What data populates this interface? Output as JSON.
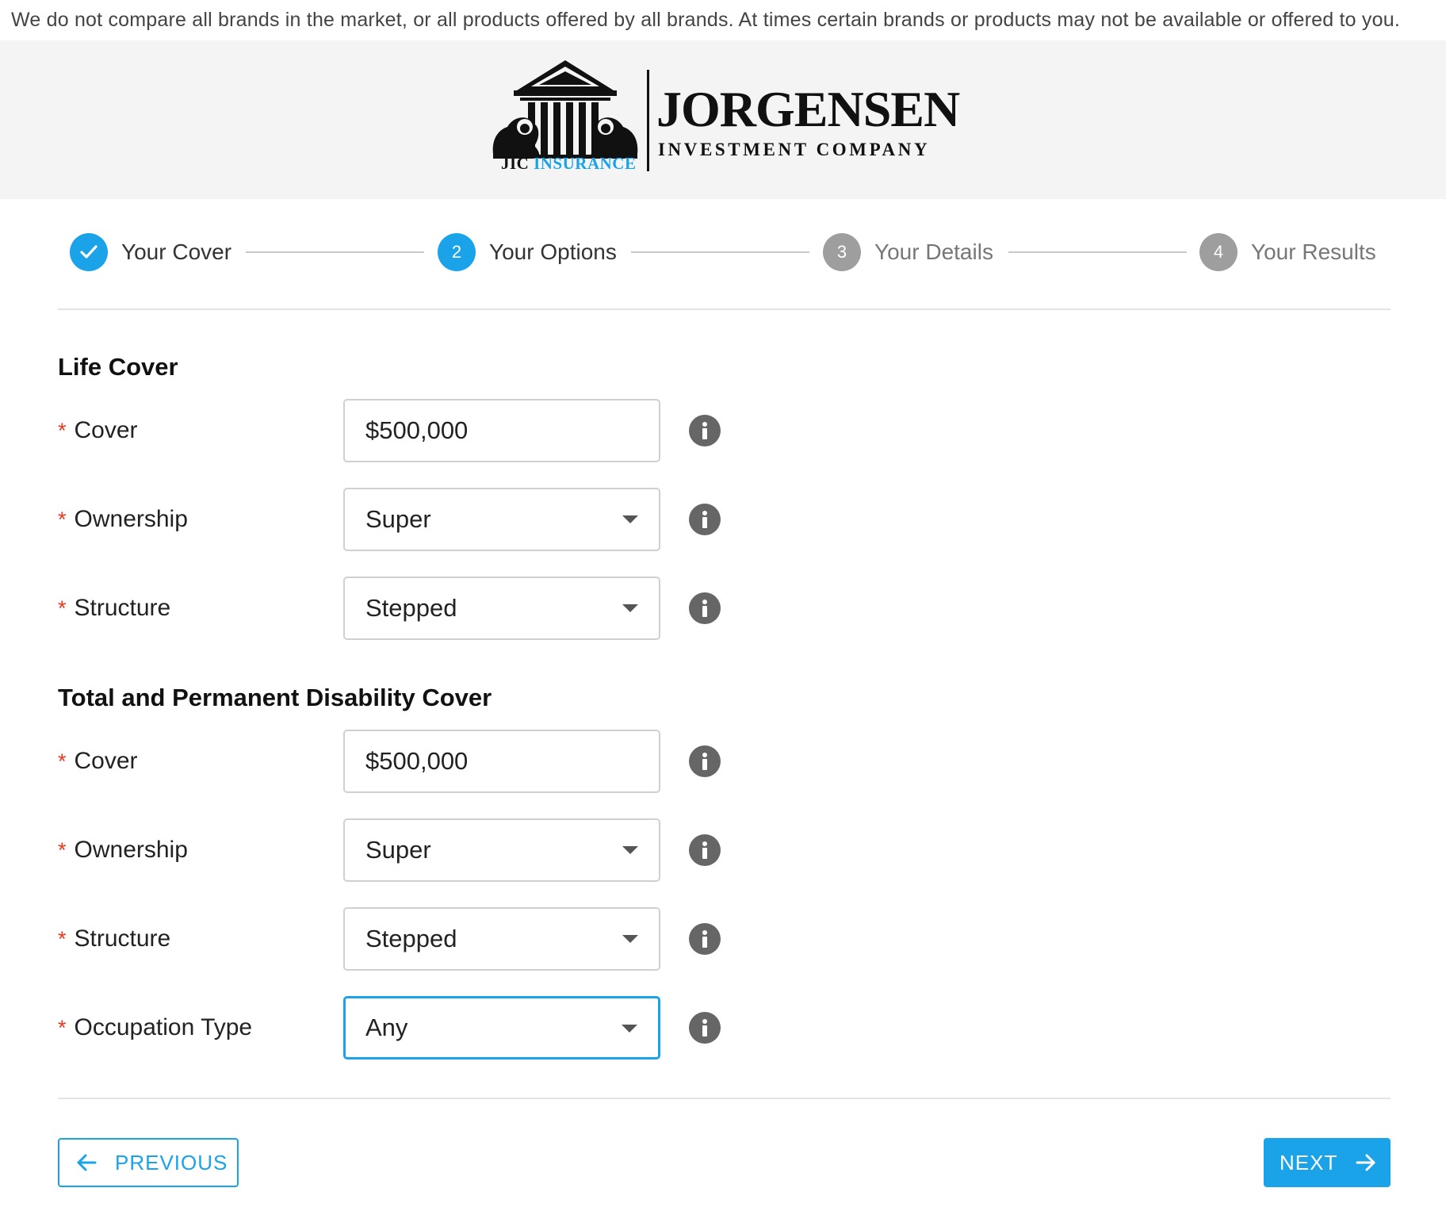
{
  "disclaimer": "We do not compare all brands in the market, or all products offered by all brands. At times certain brands or products may not be available or offered to you.",
  "logo": {
    "name": "JORGENSEN",
    "subtitle": "INVESTMENT COMPANY",
    "tag_prefix": "JIC",
    "tag_suffix": "INSURANCE"
  },
  "stepper": {
    "steps": [
      {
        "number": "",
        "label": "Your Cover",
        "state": "done"
      },
      {
        "number": "2",
        "label": "Your Options",
        "state": "active"
      },
      {
        "number": "3",
        "label": "Your Details",
        "state": "pending"
      },
      {
        "number": "4",
        "label": "Your Results",
        "state": "pending"
      }
    ]
  },
  "life_cover": {
    "title": "Life Cover",
    "cover_label": "Cover",
    "cover_value": "$500,000",
    "ownership_label": "Ownership",
    "ownership_value": "Super",
    "structure_label": "Structure",
    "structure_value": "Stepped"
  },
  "tpd_cover": {
    "title": "Total and Permanent Disability Cover",
    "cover_label": "Cover",
    "cover_value": "$500,000",
    "ownership_label": "Ownership",
    "ownership_value": "Super",
    "structure_label": "Structure",
    "structure_value": "Stepped",
    "occupation_label": "Occupation Type",
    "occupation_value": "Any"
  },
  "required_marker": "*",
  "nav": {
    "previous_label": "PREVIOUS",
    "next_label": "NEXT"
  },
  "colors": {
    "accent": "#1aa3e8",
    "required": "#e8391f",
    "pending_step": "#9e9e9e",
    "info_icon": "#666666",
    "header_bg": "#f4f4f4"
  }
}
